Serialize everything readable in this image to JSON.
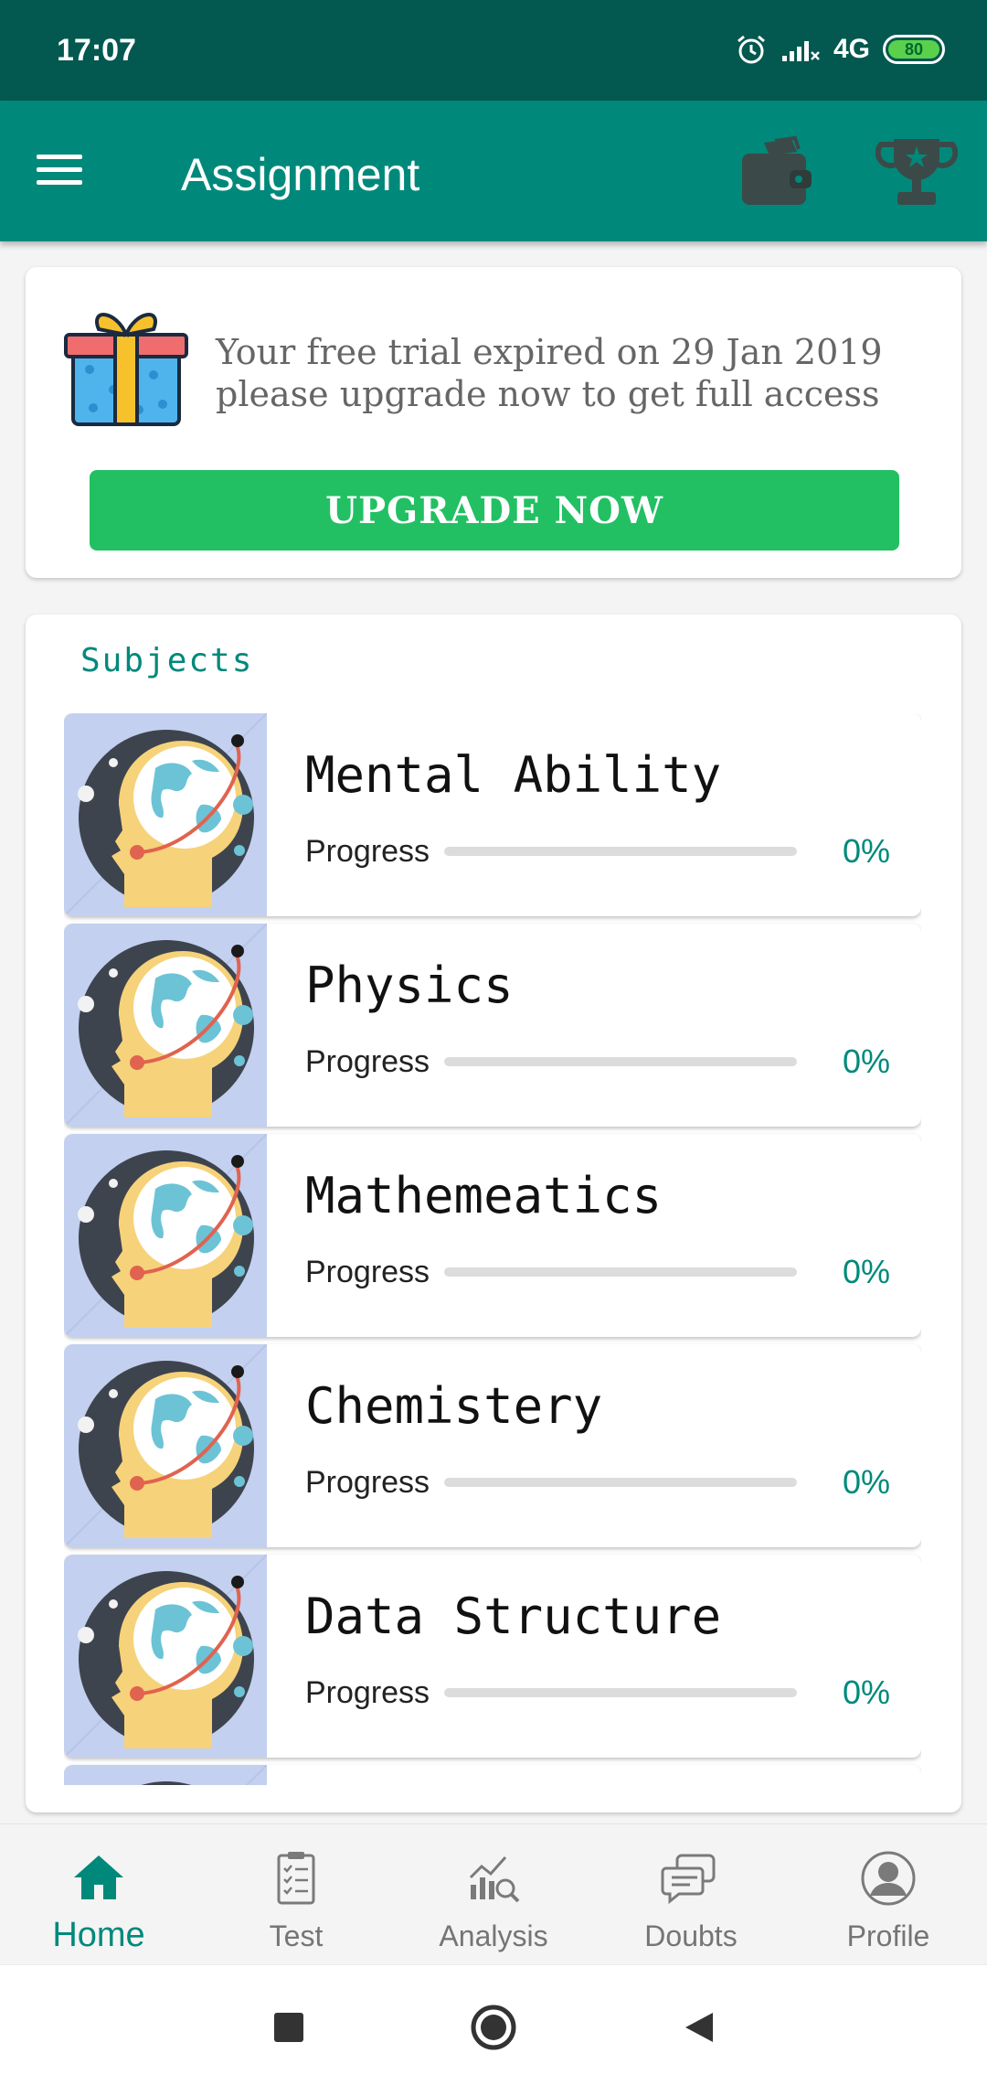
{
  "status": {
    "time": "17:07",
    "network": "4G",
    "battery": "80"
  },
  "app_bar": {
    "title": "Assignment",
    "icons": [
      "menu-icon",
      "wallet-icon",
      "trophy-icon"
    ]
  },
  "trial": {
    "message": "Your free trial expired on 29 Jan 2019 please upgrade now to get full access",
    "button_label": "UPGRADE NOW",
    "icon": "gift-icon"
  },
  "subjects": {
    "heading": "Subjects",
    "items": [
      {
        "name": "Mental Ability",
        "progress_label": "Progress",
        "progress_text": "0%",
        "progress_fraction": 0
      },
      {
        "name": "Physics",
        "progress_label": "Progress",
        "progress_text": "0%",
        "progress_fraction": 0
      },
      {
        "name": "Mathemeatics",
        "progress_label": "Progress",
        "progress_text": "0%",
        "progress_fraction": 0
      },
      {
        "name": "Chemistery",
        "progress_label": "Progress",
        "progress_text": "0%",
        "progress_fraction": 0
      },
      {
        "name": "Data Structure",
        "progress_label": "Progress",
        "progress_text": "0%",
        "progress_fraction": 0
      }
    ]
  },
  "bottom_nav": {
    "items": [
      {
        "label": "Home",
        "icon": "home-icon",
        "active": true
      },
      {
        "label": "Test",
        "icon": "clipboard-icon",
        "active": false
      },
      {
        "label": "Analysis",
        "icon": "analysis-icon",
        "active": false
      },
      {
        "label": "Doubts",
        "icon": "chat-icon",
        "active": false
      },
      {
        "label": "Profile",
        "icon": "profile-icon",
        "active": false
      }
    ]
  },
  "colors": {
    "status_bar": "#03584f",
    "primary": "#00897b",
    "upgrade_button": "#22c063",
    "accent_text": "#00897b"
  }
}
